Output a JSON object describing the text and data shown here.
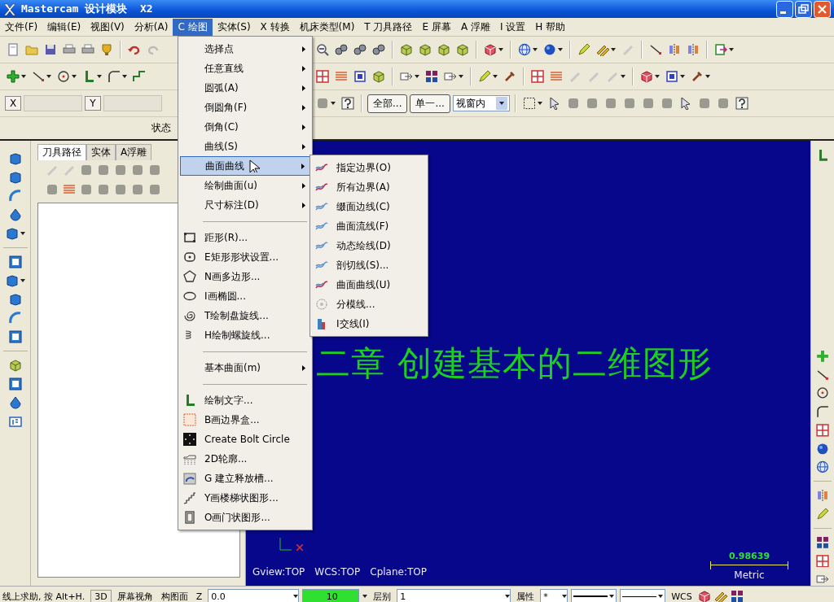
{
  "window": {
    "title": "Mastercam 设计模块  X2"
  },
  "menubar": [
    {
      "label": "文件(F)",
      "selected": false
    },
    {
      "label": "编辑(E)",
      "selected": false
    },
    {
      "label": "视图(V)",
      "selected": false
    },
    {
      "label": "分析(A)",
      "selected": false
    },
    {
      "label": "C 绘图",
      "selected": true
    },
    {
      "label": "实体(S)",
      "selected": false
    },
    {
      "label": "X 转换",
      "selected": false
    },
    {
      "label": "机床类型(M)",
      "selected": false
    },
    {
      "label": "T 刀具路径",
      "selected": false
    },
    {
      "label": "E 屏幕",
      "selected": false
    },
    {
      "label": "A 浮雕",
      "selected": false
    },
    {
      "label": "I 设置",
      "selected": false
    },
    {
      "label": "H 帮助",
      "selected": false
    }
  ],
  "toolbar": {
    "x_label": "X",
    "y_label": "Y",
    "all_button": "全部...",
    "single_button": "单一...",
    "view_select": "视窗内"
  },
  "status_strip": {
    "label": "状态"
  },
  "panel": {
    "tabs": [
      {
        "label": "刀具路径",
        "selected": true
      },
      {
        "label": "实体",
        "selected": false
      },
      {
        "label": "A浮雕",
        "selected": false
      }
    ]
  },
  "viewport": {
    "heading": "二章  创建基本的二维图形",
    "view_info": [
      "Gview:TOP",
      "WCS:TOP",
      "Cplane:TOP"
    ],
    "scale": {
      "value": "0.98639",
      "unit": "Metric"
    }
  },
  "draw_menu": {
    "items": [
      {
        "kind": "submenu",
        "label": "选择点",
        "selected": false
      },
      {
        "kind": "submenu",
        "label": "任意直线",
        "selected": false
      },
      {
        "kind": "submenu",
        "label": "圆弧(A)",
        "selected": false
      },
      {
        "kind": "submenu",
        "label": "倒圆角(F)",
        "selected": false
      },
      {
        "kind": "submenu",
        "label": "倒角(C)",
        "selected": false
      },
      {
        "kind": "submenu",
        "label": "曲线(S)",
        "selected": false
      },
      {
        "kind": "submenu",
        "label": "曲面曲线",
        "selected": true
      },
      {
        "kind": "submenu",
        "label": "绘制曲面(u)",
        "selected": false
      },
      {
        "kind": "submenu",
        "label": "尺寸标注(D)",
        "selected": false
      },
      {
        "kind": "separator"
      },
      {
        "kind": "command",
        "label": "距形(R)...",
        "selected": false
      },
      {
        "kind": "command",
        "label": "E矩形形状设置...",
        "selected": false
      },
      {
        "kind": "command",
        "label": "N画多边形...",
        "selected": false
      },
      {
        "kind": "command",
        "label": "I画椭圆...",
        "selected": false
      },
      {
        "kind": "command",
        "label": "T绘制盘旋线...",
        "selected": false
      },
      {
        "kind": "command",
        "label": "H绘制螺旋线...",
        "selected": false
      },
      {
        "kind": "separator"
      },
      {
        "kind": "submenu",
        "label": "基本曲面(m)",
        "selected": false
      },
      {
        "kind": "separator"
      },
      {
        "kind": "command",
        "label": "绘制文字...",
        "selected": false
      },
      {
        "kind": "command",
        "label": "B画边界盒...",
        "selected": false
      },
      {
        "kind": "command",
        "label": "Create Bolt Circle",
        "selected": false
      },
      {
        "kind": "command",
        "label": "2D轮廓...",
        "selected": false
      },
      {
        "kind": "command",
        "label": "G 建立释放槽...",
        "selected": false
      },
      {
        "kind": "command",
        "label": "Y画楼梯状图形...",
        "selected": false
      },
      {
        "kind": "command",
        "label": "O画门状图形...",
        "selected": false
      }
    ]
  },
  "surface_curve_menu": {
    "items": [
      {
        "label": "指定边界(O)"
      },
      {
        "label": "所有边界(A)"
      },
      {
        "label": "缀面边线(C)"
      },
      {
        "label": "曲面流线(F)"
      },
      {
        "label": "动态绘线(D)"
      },
      {
        "label": "剖切线(S)..."
      },
      {
        "label": "曲面曲线(U)"
      },
      {
        "label": "分模线..."
      },
      {
        "label": "I交线(I)"
      }
    ]
  },
  "status_bar": {
    "help": "线上求助, 按 Alt+H.",
    "view_3d": "3D",
    "screen_view": "屏幕视角",
    "cplane": "构图面",
    "z_label": "Z",
    "z_value": "0.0",
    "color_value": "10",
    "level_label": "层别",
    "level_value": "1",
    "attributes": "属性",
    "point_style": "*",
    "wcs": "WCS"
  }
}
